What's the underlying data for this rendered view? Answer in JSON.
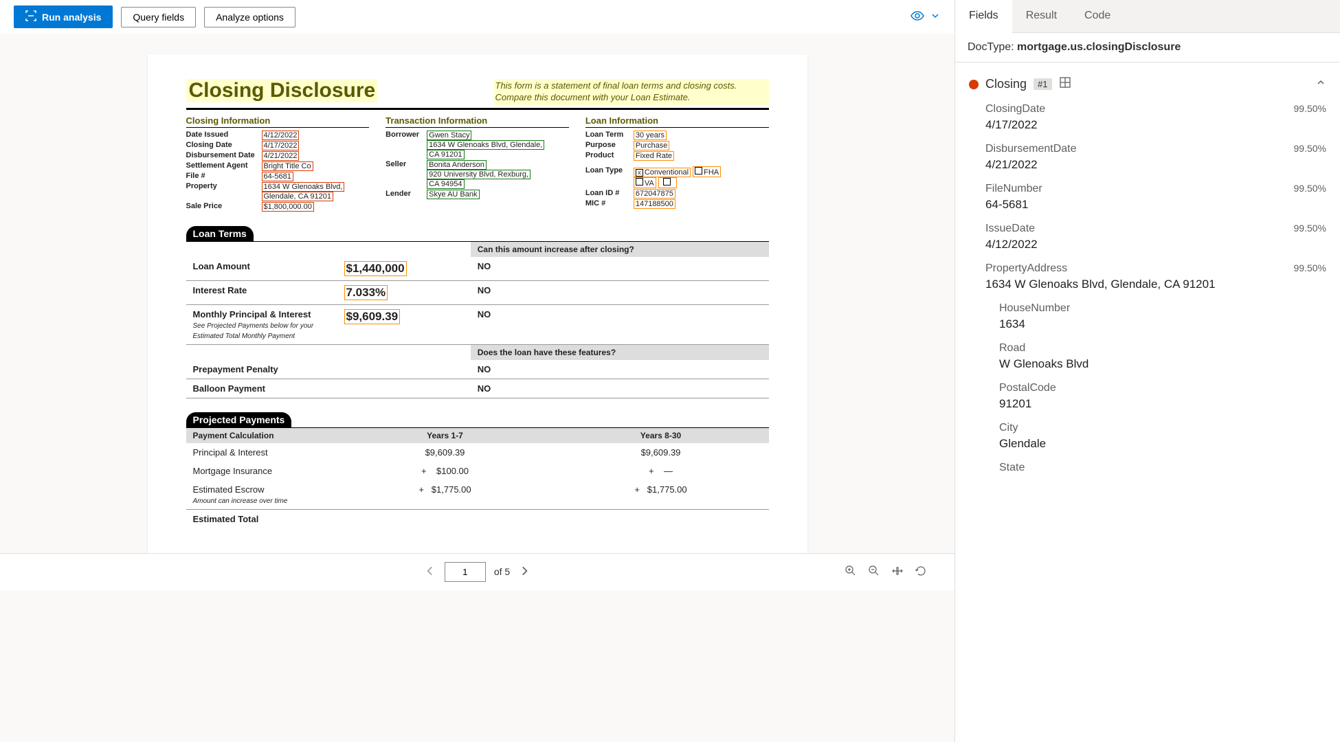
{
  "toolbar": {
    "run": "Run analysis",
    "query": "Query fields",
    "analyze": "Analyze options"
  },
  "document": {
    "title": "Closing Disclosure",
    "subtitle": "This form is a statement of final loan terms and closing costs. Compare this document with your Loan Estimate.",
    "closing_info": {
      "heading": "Closing Information",
      "date_issued_label": "Date Issued",
      "date_issued": "4/12/2022",
      "closing_date_label": "Closing Date",
      "closing_date": "4/17/2022",
      "disbursement_label": "Disbursement Date",
      "disbursement": "4/21/2022",
      "settlement_label": "Settlement Agent",
      "settlement": "Bright Title Co",
      "file_label": "File #",
      "file": "64-5681",
      "property_label": "Property",
      "property1": "1634 W Glenoaks Blvd,",
      "property2": "Glendale, CA 91201",
      "sale_price_label": "Sale Price",
      "sale_price": "$1,800,000.00"
    },
    "transaction_info": {
      "heading": "Transaction Information",
      "borrower_label": "Borrower",
      "borrower_name": "Gwen Stacy",
      "borrower_addr1": "1634 W Glenoaks Blvd, Glendale,",
      "borrower_addr2": "CA 91201",
      "seller_label": "Seller",
      "seller_name": "Bonita Anderson",
      "seller_addr1": "920 University Blvd, Rexburg,",
      "seller_addr2": "CA 94954",
      "lender_label": "Lender",
      "lender": "Skye AU Bank"
    },
    "loan_info": {
      "heading": "Loan Information",
      "term_label": "Loan Term",
      "term": "30 years",
      "purpose_label": "Purpose",
      "purpose": "Purchase",
      "product_label": "Product",
      "product": "Fixed Rate",
      "type_label": "Loan Type",
      "type_conventional": "Conventional",
      "type_fha": "FHA",
      "type_va": "VA",
      "loanid_label": "Loan ID #",
      "loanid": "672047875",
      "mic_label": "MIC #",
      "mic": "147188500"
    },
    "loan_terms": {
      "header": "Loan Terms",
      "q": "Can this amount increase after closing?",
      "amount_label": "Loan Amount",
      "amount": "$1,440,000",
      "amount_ans": "NO",
      "rate_label": "Interest Rate",
      "rate": "7.033%",
      "rate_ans": "NO",
      "mpi_label": "Monthly Principal & Interest",
      "mpi_sub": "See Projected Payments below for your Estimated Total Monthly Payment",
      "mpi": "$9,609.39",
      "mpi_ans": "NO",
      "features_q": "Does the loan have these features?",
      "prepay_label": "Prepayment Penalty",
      "prepay_ans": "NO",
      "balloon_label": "Balloon Payment",
      "balloon_ans": "NO"
    },
    "projected": {
      "header": "Projected Payments",
      "calc_label": "Payment Calculation",
      "col1": "Years 1-7",
      "col2": "Years 8-30",
      "pi_label": "Principal & Interest",
      "pi1": "$9,609.39",
      "pi2": "$9,609.39",
      "mi_label": "Mortgage Insurance",
      "mi1": "$100.00",
      "mi2": "—",
      "escrow_label": "Estimated Escrow",
      "escrow_sub": "Amount can increase over time",
      "escrow1": "$1,775.00",
      "escrow2": "$1,775.00",
      "plus": "+",
      "total_label": "Estimated Total"
    }
  },
  "pager": {
    "current": "1",
    "total": "of 5"
  },
  "tabs": {
    "fields": "Fields",
    "result": "Result",
    "code": "Code"
  },
  "doctype": {
    "label": "DocType:",
    "value": "mortgage.us.closingDisclosure"
  },
  "group": {
    "name": "Closing",
    "badge": "#1"
  },
  "fields": [
    {
      "name": "ClosingDate",
      "conf": "99.50%",
      "value": "4/17/2022"
    },
    {
      "name": "DisbursementDate",
      "conf": "99.50%",
      "value": "4/21/2022"
    },
    {
      "name": "FileNumber",
      "conf": "99.50%",
      "value": "64-5681"
    },
    {
      "name": "IssueDate",
      "conf": "99.50%",
      "value": "4/12/2022"
    },
    {
      "name": "PropertyAddress",
      "conf": "99.50%",
      "value": "1634 W Glenoaks Blvd, Glendale, CA 91201"
    }
  ],
  "nested_fields": [
    {
      "name": "HouseNumber",
      "value": "1634"
    },
    {
      "name": "Road",
      "value": "W Glenoaks Blvd"
    },
    {
      "name": "PostalCode",
      "value": "91201"
    },
    {
      "name": "City",
      "value": "Glendale"
    },
    {
      "name": "State",
      "value": ""
    }
  ]
}
